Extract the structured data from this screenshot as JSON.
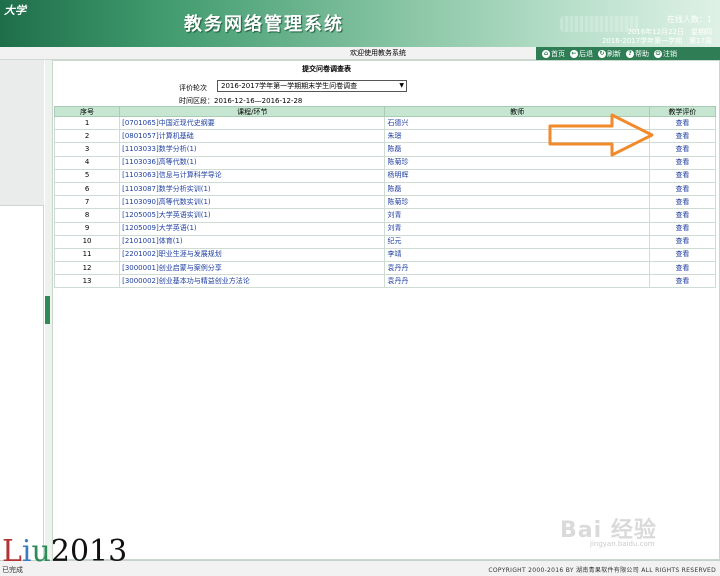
{
  "header": {
    "school": "大学",
    "system_title": "教务网络管理系统",
    "online_label": "在线人数：1",
    "date_line": "2016年12月22日　星期四",
    "term_line": "2016-2017学年第一学期　第17周"
  },
  "nav": {
    "welcome": "欢迎使用教务系统",
    "items": [
      {
        "icon": "home-icon",
        "label": "首页"
      },
      {
        "icon": "back-icon",
        "label": "后退"
      },
      {
        "icon": "refresh-icon",
        "label": "刷新"
      },
      {
        "icon": "help-icon",
        "label": "帮助"
      },
      {
        "icon": "logout-icon",
        "label": "注销"
      }
    ]
  },
  "form": {
    "title": "提交问卷调查表",
    "round_label": "评价轮次",
    "round_value": "2016-2017学年第一学期期末学生问卷调查",
    "period": "时间区段：2016-12-16—2016-12-28"
  },
  "table": {
    "headers": [
      "序号",
      "课程/环节",
      "教师",
      "教学评价"
    ],
    "rows": [
      {
        "no": "1",
        "course": "[0701065]中国近现代史纲要",
        "teacher": "石德兴",
        "action": "查看"
      },
      {
        "no": "2",
        "course": "[0801057]计算机基础",
        "teacher": "朱璟",
        "action": "查看"
      },
      {
        "no": "3",
        "course": "[1103033]数学分析(1)",
        "teacher": "陈磊",
        "action": "查看"
      },
      {
        "no": "4",
        "course": "[1103036]高等代数(1)",
        "teacher": "陈菊珍",
        "action": "查看"
      },
      {
        "no": "5",
        "course": "[1103063]信息与计算科学导论",
        "teacher": "杨明辉",
        "action": "查看"
      },
      {
        "no": "6",
        "course": "[1103087]数学分析实训(1)",
        "teacher": "陈磊",
        "action": "查看"
      },
      {
        "no": "7",
        "course": "[1103090]高等代数实训(1)",
        "teacher": "陈菊珍",
        "action": "查看"
      },
      {
        "no": "8",
        "course": "[1205005]大学英语实训(1)",
        "teacher": "刘青",
        "action": "查看"
      },
      {
        "no": "9",
        "course": "[1205009]大学英语(1)",
        "teacher": "刘青",
        "action": "查看"
      },
      {
        "no": "10",
        "course": "[2101001]体育(1)",
        "teacher": "纪元",
        "action": "查看"
      },
      {
        "no": "11",
        "course": "[2201002]职业生涯与发展规划",
        "teacher": "李靖",
        "action": "查看"
      },
      {
        "no": "12",
        "course": "[3000001]创业启蒙与案例分享",
        "teacher": "袁丹丹",
        "action": "查看"
      },
      {
        "no": "13",
        "course": "[3000002]创业基本功与精益创业方法论",
        "teacher": "袁丹丹",
        "action": "查看"
      }
    ]
  },
  "footer": {
    "status": "已完成",
    "copyright": "COPYRIGHT 2000-2016 BY 湖南青果软件有限公司 ALL RIGHTS RESERVED"
  },
  "overlays": {
    "signature": [
      "L",
      "i",
      "u",
      "2013"
    ],
    "baidu_logo": "Bai 经验",
    "baidu_url": "jingyan.baidu.com"
  },
  "colors": {
    "header_green": "#2e7d55",
    "link_blue": "#1f3fa0",
    "table_header": "#c7e6d2",
    "arrow": "#f08a2a"
  }
}
